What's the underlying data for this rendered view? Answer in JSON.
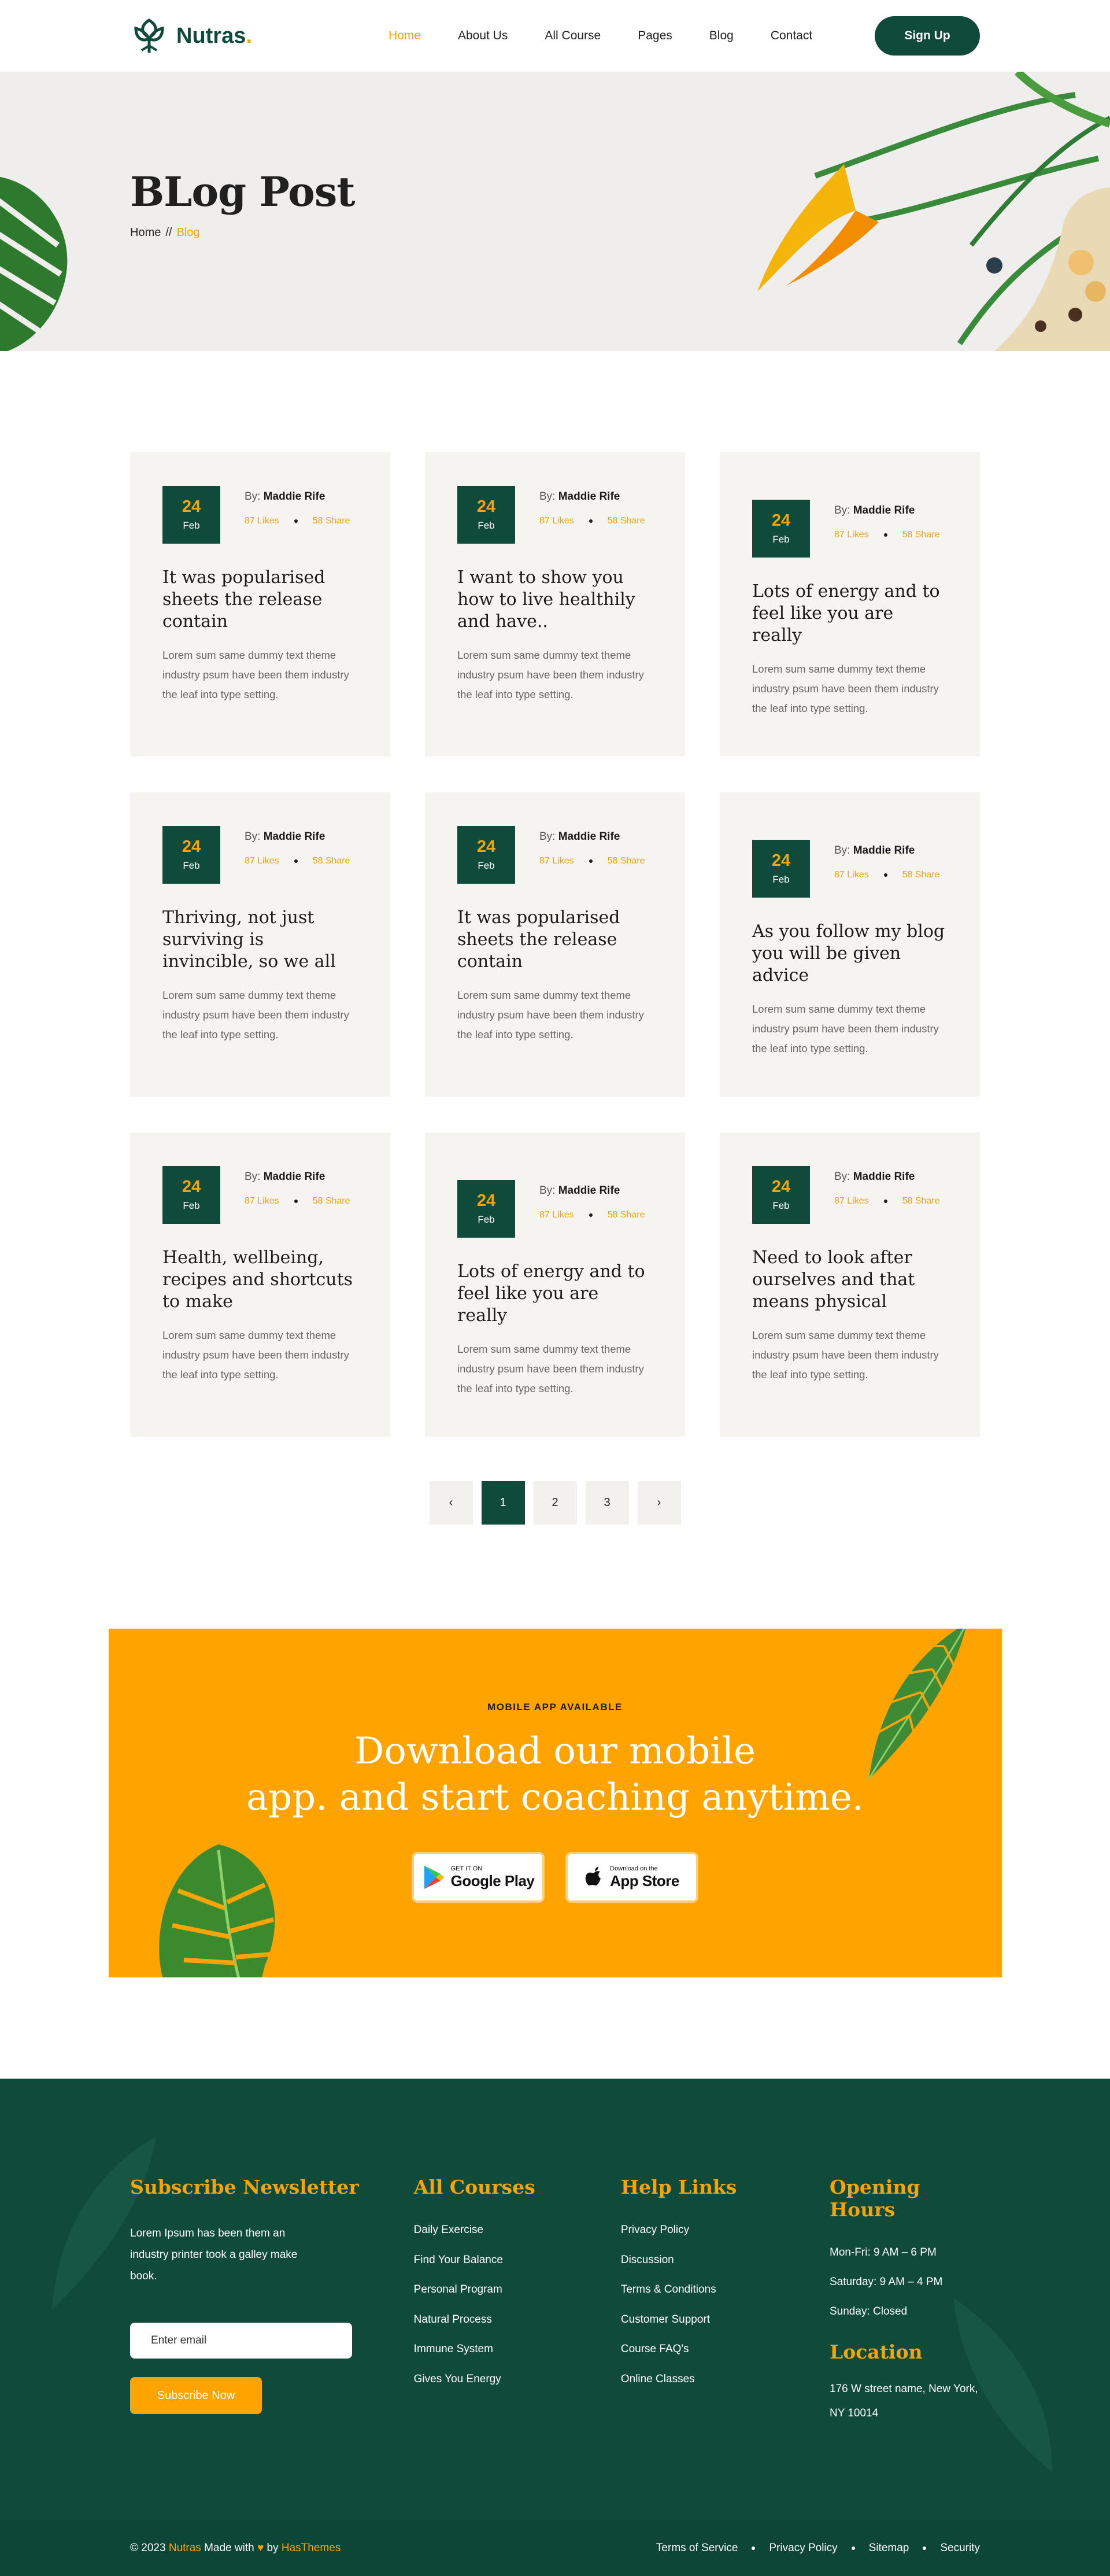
{
  "header": {
    "brand": "Nutras",
    "brand_dot": ".",
    "nav": [
      "Home",
      "About Us",
      "All Course",
      "Pages",
      "Blog",
      "Contact"
    ],
    "active_index": 0,
    "signup_label": "Sign Up"
  },
  "hero": {
    "title": "BLog Post",
    "breadcrumb_home": "Home",
    "breadcrumb_sep": "//",
    "breadcrumb_current": "Blog"
  },
  "posts": [
    {
      "day": "24",
      "month": "Feb",
      "by_label": "By:",
      "author": "Maddie Rife",
      "likes": "87 Likes",
      "shares": "58 Share",
      "title": "It was popularised sheets the release contain",
      "excerpt": "Lorem sum same dummy text theme industry psum have been them industry the leaf into type setting."
    },
    {
      "day": "24",
      "month": "Feb",
      "by_label": "By:",
      "author": "Maddie Rife",
      "likes": "87 Likes",
      "shares": "58 Share",
      "title": "I want to show you how to live healthily and have..",
      "excerpt": "Lorem sum same dummy text theme industry psum have been them industry the leaf into type setting."
    },
    {
      "day": "24",
      "month": "Feb",
      "by_label": "By:",
      "author": "Maddie Rife",
      "likes": "87 Likes",
      "shares": "58 Share",
      "title": "Lots of energy and to feel like you are really",
      "excerpt": "Lorem sum same dummy text theme industry psum have been them industry the leaf into type setting."
    },
    {
      "day": "24",
      "month": "Feb",
      "by_label": "By:",
      "author": "Maddie Rife",
      "likes": "87 Likes",
      "shares": "58 Share",
      "title": "Thriving, not just surviving is invincible, so we all",
      "excerpt": "Lorem sum same dummy text theme industry psum have been them industry the leaf into type setting."
    },
    {
      "day": "24",
      "month": "Feb",
      "by_label": "By:",
      "author": "Maddie Rife",
      "likes": "87 Likes",
      "shares": "58 Share",
      "title": "It was popularised sheets the release contain",
      "excerpt": "Lorem sum same dummy text theme industry psum have been them industry the leaf into type setting."
    },
    {
      "day": "24",
      "month": "Feb",
      "by_label": "By:",
      "author": "Maddie Rife",
      "likes": "87 Likes",
      "shares": "58 Share",
      "title": "As you follow my blog you will be given advice",
      "excerpt": "Lorem sum same dummy text theme industry psum have been them industry the leaf into type setting."
    },
    {
      "day": "24",
      "month": "Feb",
      "by_label": "By:",
      "author": "Maddie Rife",
      "likes": "87 Likes",
      "shares": "58 Share",
      "title": "Health, wellbeing, recipes and shortcuts to make",
      "excerpt": "Lorem sum same dummy text theme industry psum have been them industry the leaf into type setting."
    },
    {
      "day": "24",
      "month": "Feb",
      "by_label": "By:",
      "author": "Maddie Rife",
      "likes": "87 Likes",
      "shares": "58 Share",
      "title": "Lots of energy and to feel like you are really",
      "excerpt": "Lorem sum same dummy text theme industry psum have been them industry the leaf into type setting."
    },
    {
      "day": "24",
      "month": "Feb",
      "by_label": "By:",
      "author": "Maddie Rife",
      "likes": "87 Likes",
      "shares": "58 Share",
      "title": "Need to look after ourselves and that means physical",
      "excerpt": "Lorem sum same dummy text theme industry psum have been them industry the leaf into type setting."
    }
  ],
  "pagination": {
    "prev": "‹",
    "pages": [
      "1",
      "2",
      "3"
    ],
    "current": "1",
    "next": "›"
  },
  "cta": {
    "kicker": "MOBILE APP AVAILABLE",
    "title_line1": "Download our mobile",
    "title_line2": "app. and start coaching anytime.",
    "google_small": "GET IT ON",
    "google_big": "Google Play",
    "apple_small": "Download on the",
    "apple_big": "App Store"
  },
  "footer": {
    "newsletter_title": "Subscribe Newsletter",
    "newsletter_text": "Lorem Ipsum has been them an industry printer took a galley make book.",
    "email_placeholder": "Enter email",
    "subscribe_label": "Subscribe Now",
    "courses_title": "All Courses",
    "courses": [
      "Daily Exercise",
      "Find Your Balance",
      "Personal Program",
      "Natural Process",
      "Immune System",
      "Gives You Energy"
    ],
    "help_title": "Help Links",
    "help": [
      "Privacy Policy",
      "Discussion",
      "Terms & Conditions",
      "Customer Support",
      "Course FAQ's",
      "Online Classes"
    ],
    "hours_title": "Opening Hours",
    "hours": [
      "Mon-Fri: 9 AM – 6 PM",
      "Saturday: 9 AM – 4 PM",
      "Sunday: Closed"
    ],
    "location_title": "Location",
    "address": "176 W street name, New York, NY 10014",
    "copyright_pre": "© 2023",
    "copyright_brand": "Nutras",
    "copyright_mid": "Made with",
    "copyright_by": "by",
    "copyright_author": "HasThemes",
    "legal_links": [
      "Terms of Service",
      "Privacy Policy",
      "Sitemap",
      "Security"
    ]
  },
  "colors": {
    "primary_green": "#0f4a3a",
    "accent_orange": "#f5a400",
    "cta_orange": "#ffa300",
    "card_bg": "#f6f4f1"
  }
}
